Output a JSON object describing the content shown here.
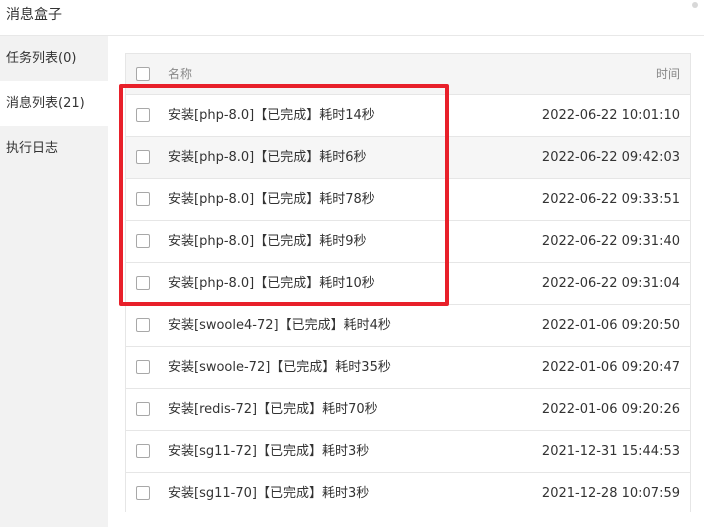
{
  "window": {
    "title": "消息盒子"
  },
  "sidebar": {
    "items": [
      {
        "label": "任务列表(0)"
      },
      {
        "label": "消息列表(21)"
      },
      {
        "label": "执行日志"
      }
    ]
  },
  "table": {
    "header": {
      "name": "名称",
      "time": "时间"
    },
    "rows": [
      {
        "name": "安装[php-8.0]【已完成】耗时14秒",
        "time": "2022-06-22 10:01:10"
      },
      {
        "name": "安装[php-8.0]【已完成】耗时6秒",
        "time": "2022-06-22 09:42:03"
      },
      {
        "name": "安装[php-8.0]【已完成】耗时78秒",
        "time": "2022-06-22 09:33:51"
      },
      {
        "name": "安装[php-8.0]【已完成】耗时9秒",
        "time": "2022-06-22 09:31:40"
      },
      {
        "name": "安装[php-8.0]【已完成】耗时10秒",
        "time": "2022-06-22 09:31:04"
      },
      {
        "name": "安装[swoole4-72]【已完成】耗时4秒",
        "time": "2022-01-06 09:20:50"
      },
      {
        "name": "安装[swoole-72]【已完成】耗时35秒",
        "time": "2022-01-06 09:20:47"
      },
      {
        "name": "安装[redis-72]【已完成】耗时70秒",
        "time": "2022-01-06 09:20:26"
      },
      {
        "name": "安装[sg11-72]【已完成】耗时3秒",
        "time": "2021-12-31 15:44:53"
      },
      {
        "name": "安装[sg11-70]【已完成】耗时3秒",
        "time": "2021-12-28 10:07:59"
      }
    ]
  },
  "colors": {
    "highlight": "#e8202a",
    "sidebar_bg": "#f2f2f2",
    "header_bg": "#f5f5f5"
  }
}
